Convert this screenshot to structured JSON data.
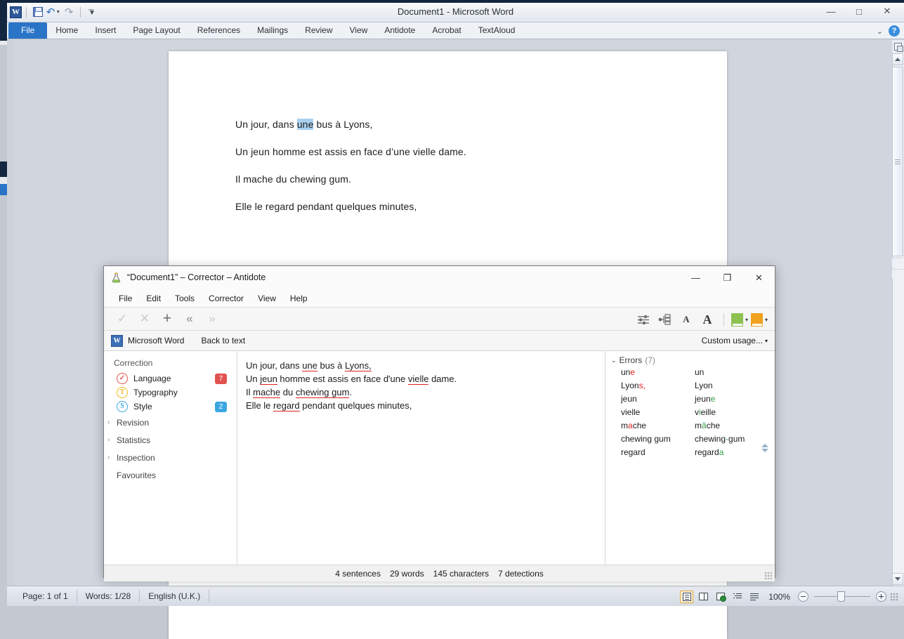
{
  "word": {
    "title": "Document1  -  Microsoft Word",
    "quick_access": {
      "app_logo": "word-logo",
      "save": "save-icon",
      "undo": "undo-icon",
      "redo": "redo-icon",
      "customize": "customize-qat-icon"
    },
    "window_buttons": {
      "minimize": "—",
      "maximize": "□",
      "close": "✕"
    },
    "ribbon_tabs": [
      "File",
      "Home",
      "Insert",
      "Page Layout",
      "References",
      "Mailings",
      "Review",
      "View",
      "Antidote",
      "Acrobat",
      "TextAloud"
    ],
    "ribbon_right": {
      "collapse": "⌄",
      "help": "?"
    },
    "document": {
      "paragraphs": [
        {
          "before": "Un jour, dans ",
          "selected": "une",
          "after": " bus à Lyons,"
        },
        {
          "text": "Un jeun homme est assis en face d’une vielle dame."
        },
        {
          "text": "Il mache du chewing gum."
        },
        {
          "text": "Elle le regard pendant quelques minutes,"
        }
      ]
    },
    "status_bar": {
      "page": "Page: 1 of 1",
      "words": "Words: 1/28",
      "language": "English (U.K.)",
      "zoom_level": "100%",
      "views": [
        "print-layout-view",
        "full-screen-reading-view",
        "web-layout-view",
        "outline-view",
        "draft-view"
      ]
    }
  },
  "antidote": {
    "title": "“Document1” – Corrector – Antidote",
    "icon": "flask-icon",
    "window_buttons": {
      "minimize": "—",
      "maximize": "❐",
      "close": "✕"
    },
    "menus": [
      "File",
      "Edit",
      "Tools",
      "Corrector",
      "View",
      "Help"
    ],
    "toolbar": {
      "accept": "✓",
      "reject": "✕",
      "add": "+",
      "previous": "«",
      "next": "»",
      "settings": "sliders-icon",
      "structure": "hierarchy-icon",
      "font_small": "A",
      "font_large": "A",
      "green_book": "green-dictionary",
      "orange_book": "orange-guide",
      "caret": "▾"
    },
    "appbar": {
      "host_app": "Microsoft Word",
      "back_to_text": "Back to text",
      "usage": "Custom usage...",
      "usage_caret": "▾"
    },
    "sidebar": {
      "section": "Correction",
      "categories": [
        {
          "label": "Language",
          "icon": "✓",
          "badge": "7",
          "color": "#e0524f"
        },
        {
          "label": "Typography",
          "icon": "T",
          "badge": "",
          "color": "#f0b91e"
        },
        {
          "label": "Style",
          "icon": "S",
          "badge": "2",
          "color": "#3aa7e0"
        }
      ],
      "groups": [
        "Revision",
        "Statistics",
        "Inspection"
      ],
      "favourites": "Favourites",
      "chevron": "›"
    },
    "corrector_text": [
      [
        {
          "t": "Un jour, dans ",
          "e": false
        },
        {
          "t": "une",
          "e": true
        },
        {
          "t": " bus à ",
          "e": false
        },
        {
          "t": "Lyons,",
          "e": true
        }
      ],
      [
        {
          "t": "Un ",
          "e": false
        },
        {
          "t": "jeun",
          "e": true
        },
        {
          "t": " homme est assis en face d'une ",
          "e": false
        },
        {
          "t": "vielle",
          "e": true
        },
        {
          "t": " dame.",
          "e": false
        }
      ],
      [
        {
          "t": "Il ",
          "e": false
        },
        {
          "t": "mache",
          "e": true
        },
        {
          "t": " du ",
          "e": false
        },
        {
          "t": "chewing gum",
          "e": true
        },
        {
          "t": ".",
          "e": false
        }
      ],
      [
        {
          "t": "Elle le ",
          "e": false
        },
        {
          "t": "regard",
          "e": true
        },
        {
          "t": " pendant quelques minutes,",
          "e": false
        }
      ]
    ],
    "errors_panel": {
      "title": "Errors",
      "count": "(7)",
      "chevron": "⌄",
      "rows": [
        {
          "src": [
            {
              "t": "un",
              "c": ""
            },
            {
              "t": "e",
              "c": "hl-red"
            }
          ],
          "dst": [
            {
              "t": "un",
              "c": ""
            }
          ]
        },
        {
          "src": [
            {
              "t": "Lyon",
              "c": ""
            },
            {
              "t": "s,",
              "c": "hl-red"
            }
          ],
          "dst": [
            {
              "t": "Lyon",
              "c": ""
            }
          ]
        },
        {
          "src": [
            {
              "t": "jeun",
              "c": ""
            }
          ],
          "dst": [
            {
              "t": "jeun",
              "c": ""
            },
            {
              "t": "e",
              "c": "hl-green"
            }
          ]
        },
        {
          "src": [
            {
              "t": "vielle",
              "c": ""
            }
          ],
          "dst": [
            {
              "t": "v",
              "c": ""
            },
            {
              "t": "i",
              "c": "hl-green"
            },
            {
              "t": "eille",
              "c": ""
            }
          ]
        },
        {
          "src": [
            {
              "t": "m",
              "c": ""
            },
            {
              "t": "a",
              "c": "hl-red"
            },
            {
              "t": "che",
              "c": ""
            }
          ],
          "dst": [
            {
              "t": "m",
              "c": ""
            },
            {
              "t": "â",
              "c": "hl-green"
            },
            {
              "t": "che",
              "c": ""
            }
          ]
        },
        {
          "src": [
            {
              "t": "chewing gum",
              "c": ""
            }
          ],
          "dst": [
            {
              "t": "chewing",
              "c": ""
            },
            {
              "t": "-",
              "c": "hl-green"
            },
            {
              "t": "gum",
              "c": ""
            }
          ]
        },
        {
          "src": [
            {
              "t": "regard",
              "c": ""
            }
          ],
          "dst": [
            {
              "t": "regard",
              "c": ""
            },
            {
              "t": "a",
              "c": "hl-green"
            }
          ]
        }
      ]
    },
    "status_bar": {
      "sentences": "4 sentences",
      "words": "29 words",
      "characters": "145 characters",
      "detections": "7 detections"
    }
  }
}
